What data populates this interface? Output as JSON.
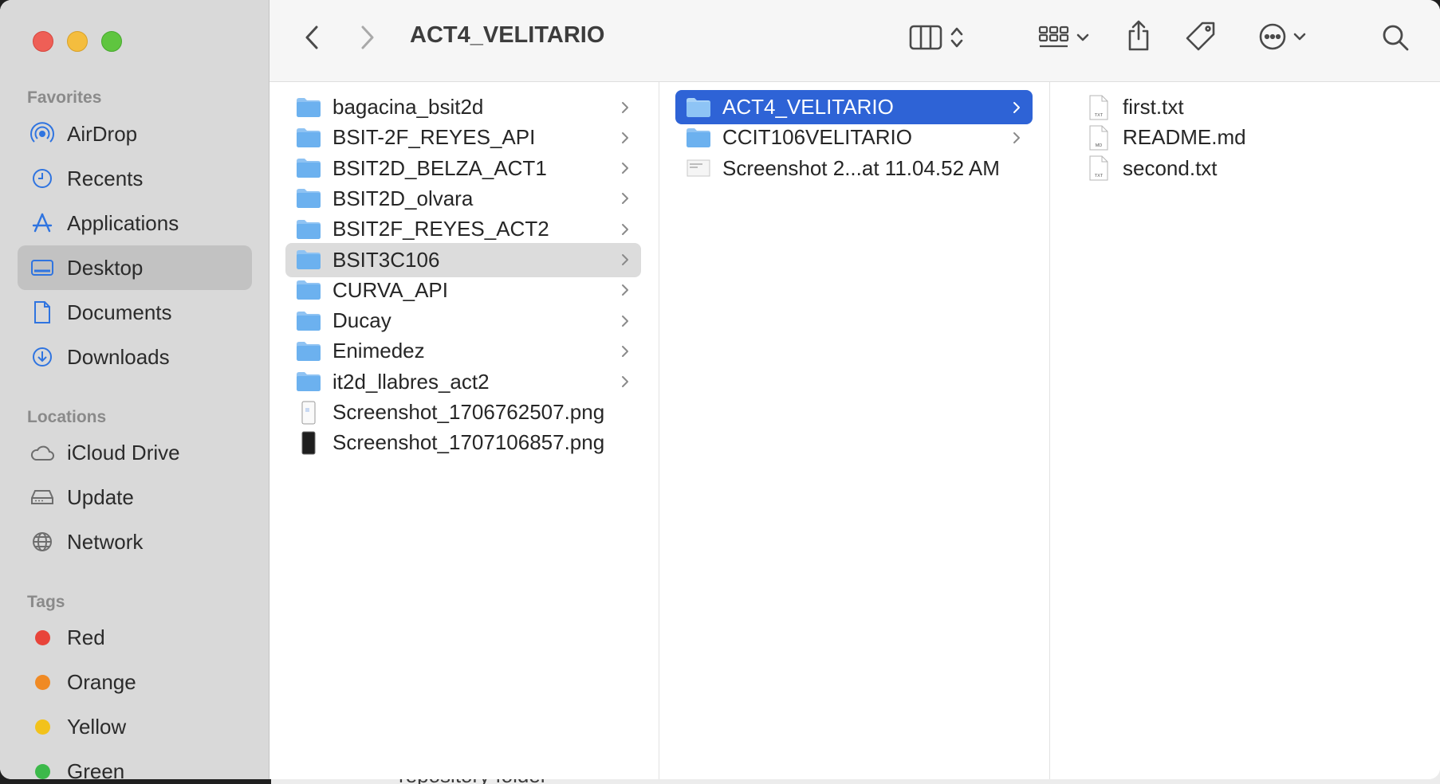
{
  "window": {
    "title": "ACT4_VELITARIO"
  },
  "background": {
    "peek_text": "repository folder"
  },
  "sidebar": {
    "favorites_label": "Favorites",
    "favorites": [
      {
        "label": "AirDrop",
        "icon": "airdrop-icon"
      },
      {
        "label": "Recents",
        "icon": "clock-icon"
      },
      {
        "label": "Applications",
        "icon": "applications-icon"
      },
      {
        "label": "Desktop",
        "icon": "desktop-icon",
        "selected": true
      },
      {
        "label": "Documents",
        "icon": "document-icon"
      },
      {
        "label": "Downloads",
        "icon": "download-icon"
      }
    ],
    "locations_label": "Locations",
    "locations": [
      {
        "label": "iCloud Drive",
        "icon": "cloud-icon"
      },
      {
        "label": "Update",
        "icon": "drive-icon"
      },
      {
        "label": "Network",
        "icon": "globe-icon"
      }
    ],
    "tags_label": "Tags",
    "tags": [
      {
        "label": "Red",
        "color": "#e8443a"
      },
      {
        "label": "Orange",
        "color": "#f08a24"
      },
      {
        "label": "Yellow",
        "color": "#f2c21b"
      },
      {
        "label": "Green",
        "color": "#3cb94a"
      }
    ]
  },
  "toolbar": {
    "back_icon": "chevron-left-icon",
    "forward_icon": "chevron-right-icon",
    "view_icon": "column-view-icon",
    "group_icon": "grid-group-icon",
    "share_icon": "share-icon",
    "tag_icon": "tag-icon",
    "more_icon": "ellipsis-circle-icon",
    "search_icon": "search-icon"
  },
  "columns": {
    "col1": [
      {
        "label": "bagacina_bsit2d",
        "kind": "folder"
      },
      {
        "label": "BSIT-2F_REYES_API",
        "kind": "folder"
      },
      {
        "label": "BSIT2D_BELZA_ACT1",
        "kind": "folder"
      },
      {
        "label": "BSIT2D_olvara",
        "kind": "folder"
      },
      {
        "label": "BSIT2F_REYES_ACT2",
        "kind": "folder"
      },
      {
        "label": "BSIT3C106",
        "kind": "folder",
        "selected": true
      },
      {
        "label": "CURVA_API",
        "kind": "folder"
      },
      {
        "label": "Ducay",
        "kind": "folder"
      },
      {
        "label": "Enimedez",
        "kind": "folder"
      },
      {
        "label": "it2d_llabres_act2",
        "kind": "folder"
      },
      {
        "label": "Screenshot_1706762507.png",
        "kind": "png-light"
      },
      {
        "label": "Screenshot_1707106857.png",
        "kind": "png-dark"
      }
    ],
    "col2": [
      {
        "label": "ACT4_VELITARIO",
        "kind": "folder",
        "selected": true
      },
      {
        "label": "CCIT106VELITARIO",
        "kind": "folder"
      },
      {
        "label": "Screenshot 2...at 11.04.52 AM",
        "kind": "image"
      }
    ],
    "col3": [
      {
        "label": "first.txt",
        "kind": "doc",
        "badge": "TXT"
      },
      {
        "label": "README.md",
        "kind": "doc",
        "badge": "MD"
      },
      {
        "label": "second.txt",
        "kind": "doc",
        "badge": "TXT"
      }
    ]
  }
}
